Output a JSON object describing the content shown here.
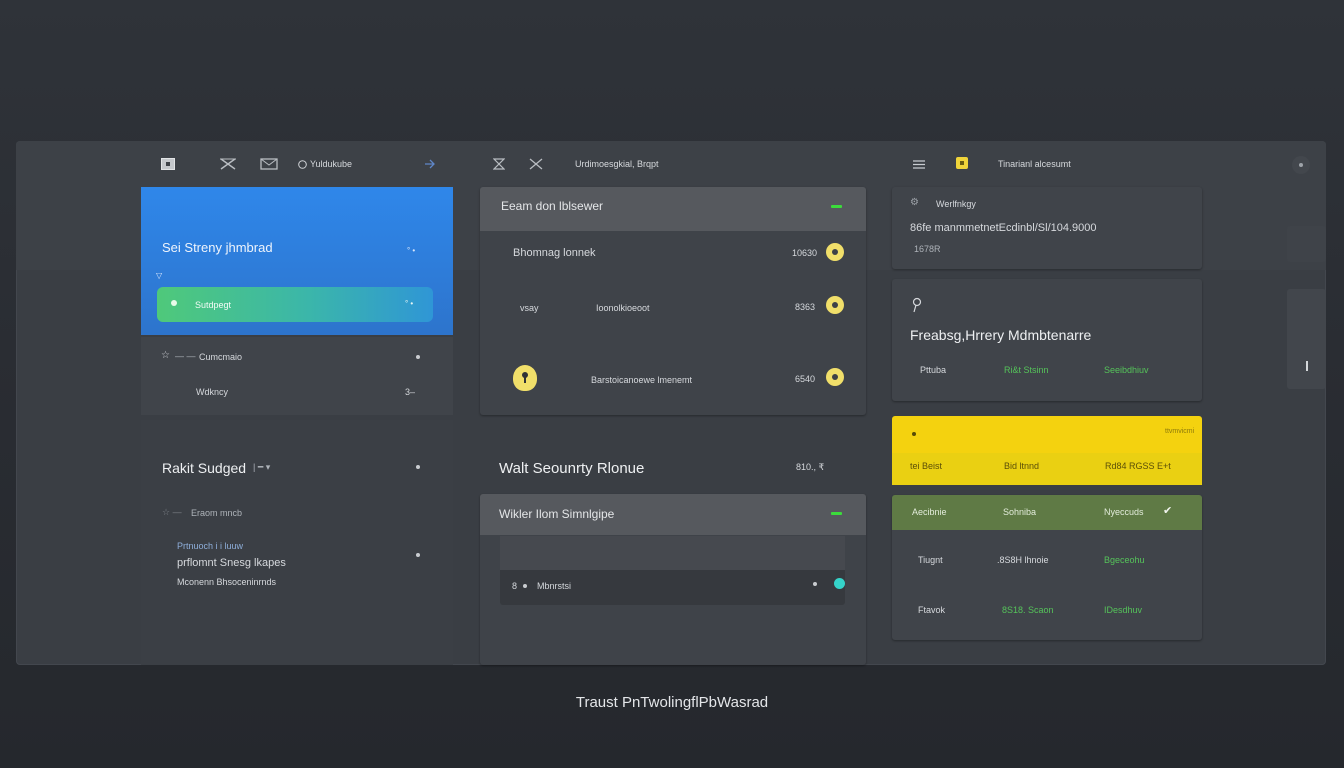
{
  "toolbar": {
    "left_label": "Yuldukube",
    "center_label": "Urdimoesgkial, Brqpt",
    "right_label": "Tinarianl alcesumt"
  },
  "left": {
    "blue_card": {
      "title": "Sei Streny jhmbrad",
      "item_label": "Sutdpegt"
    },
    "list": [
      {
        "label": "Cumcmaio"
      },
      {
        "label": "Wdkncy",
        "value": "3–"
      }
    ],
    "section2": {
      "title": "Rakit Sudged",
      "subtitle": "Eraom mncb",
      "line1": "Prtnuoch i i  luuw",
      "line2": "prflomnt Snesg lkapes",
      "line3": "Mconenn Bhsoceninrnds"
    }
  },
  "middle": {
    "card1": {
      "header": "Eeam don lblsewer",
      "rows": [
        {
          "label": "Bhomnag lonnek",
          "value": "10630"
        },
        {
          "label": "vsay",
          "sub": "Ioonolkioeoot",
          "value": "8363"
        },
        {
          "sub": "Barstoicanoewe lmenemt",
          "value": "6540"
        }
      ]
    },
    "section_title": "Walt Seounrty Rlonue",
    "section_value": "810., ₹",
    "card2": {
      "header": "Wikler Ilom Simnlgipe",
      "row_label": "Mbnrstsi",
      "row_prefix": "8"
    }
  },
  "right": {
    "card1": {
      "title": "Werlfnkgy",
      "line": "86fe manmmetnetEcdinbl/Sl/104.9000",
      "sub": "1678R"
    },
    "card2": {
      "title": "Freabsg,Hrrery Mdmbtenarre",
      "cols": [
        "Pttuba",
        "Ri&t Stsinn",
        "Seeibdhiuv"
      ]
    },
    "yellow": {
      "top_right": "ttvmvicmi",
      "cols": [
        "tei Beist",
        "Bid ltnnd",
        "Rd84 RGSS E+t"
      ]
    },
    "table": {
      "header": [
        "Aecibnie",
        "Sohniba",
        "Nyeccuds"
      ],
      "rows": [
        [
          "Tiugnt",
          ".8S8H lhnoie",
          "Bgeceohu"
        ],
        [
          "Ftavok",
          "8S18. Scaon",
          "IDesdhuv"
        ]
      ]
    }
  },
  "footer": {
    "label": "Traust PnTwolingflPbWasrad"
  },
  "colors": {
    "blue": "#2a86ea",
    "green": "#3bdc3b",
    "yellow": "#f4d20f",
    "olive": "#5f7a45",
    "teal": "#35d3c9"
  }
}
